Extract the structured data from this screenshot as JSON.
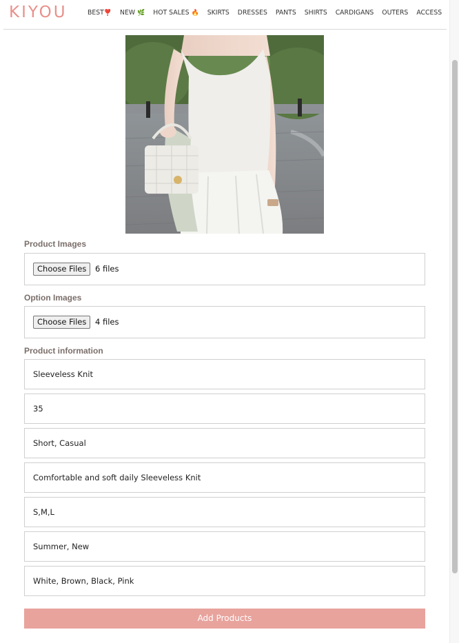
{
  "brand": {
    "logo": "KIYOU",
    "accent": "#e8908b"
  },
  "nav": [
    {
      "label": "BEST",
      "emoji": "❣️"
    },
    {
      "label": "NEW",
      "emoji": "🌿"
    },
    {
      "label": "HOT SALES",
      "emoji": "🔥"
    },
    {
      "label": "SKIRTS",
      "emoji": ""
    },
    {
      "label": "DRESSES",
      "emoji": ""
    },
    {
      "label": "PANTS",
      "emoji": ""
    },
    {
      "label": "SHIRTS",
      "emoji": ""
    },
    {
      "label": "CARDIGANS",
      "emoji": ""
    },
    {
      "label": "OUTERS",
      "emoji": ""
    },
    {
      "label": "ACCESSORIES",
      "emoji": ""
    }
  ],
  "form": {
    "product_images": {
      "label": "Product Images",
      "button": "Choose Files",
      "count": "6 files"
    },
    "option_images": {
      "label": "Option Images",
      "button": "Choose Files",
      "count": "4 files"
    },
    "info_label": "Product information",
    "fields": [
      "Sleeveless Knit",
      "35",
      "Short, Casual",
      "Comfortable and soft daily Sleeveless Knit",
      "S,M,L",
      "Summer, New",
      "White, Brown, Black, Pink"
    ],
    "submit_label": "Add Products",
    "submit_color": "#e8a39d"
  },
  "photo_icon": "product-photo-model-sleeveless-knit"
}
